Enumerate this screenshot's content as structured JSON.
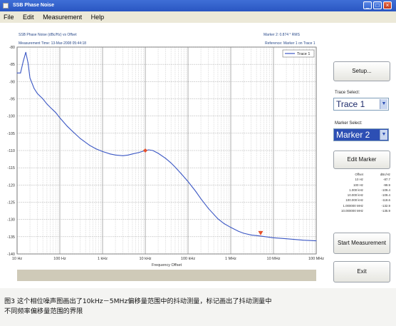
{
  "window": {
    "title": "SSB Phase Noise",
    "controls": [
      "_",
      "□",
      "×"
    ]
  },
  "menu": [
    "File",
    "Edit",
    "Measurement",
    "Help"
  ],
  "plot": {
    "title": "SSB Phase Noise (dBc/Hz) vs Offset",
    "marker_readout": "Marker 2: 0.874 ° RMS",
    "measurement_time": "Measurement Time: 13-Mar-2008 05:44:18",
    "reference": "Reference: Marker 1 on Trace 1",
    "legend": "Trace 1",
    "xlabel": "Frequency Offset"
  },
  "chart_data": {
    "type": "line",
    "title": "SSB Phase Noise (dBc/Hz) vs Offset",
    "xlabel": "Frequency Offset",
    "ylabel": "",
    "xscale": "log",
    "xlim": [
      10,
      100000000
    ],
    "ylim": [
      -140,
      -80
    ],
    "grid": true,
    "legend_position": "top-right",
    "x_tick_labels": [
      "10 Hz",
      "100 Hz",
      "1 kHz",
      "10 kHz",
      "100 kHz",
      "1 MHz",
      "10 MHz",
      "100 MHz"
    ],
    "y_tick_labels": [
      "-80",
      "-85",
      "-90",
      "-95",
      "-100",
      "-105",
      "-110",
      "-115",
      "-120",
      "-125",
      "-130",
      "-135",
      "-140"
    ],
    "series": [
      {
        "name": "Trace 1",
        "color": "#3b57c4",
        "x": [
          10,
          12,
          14,
          16,
          18,
          20,
          25,
          30,
          40,
          50,
          60,
          80,
          100,
          150,
          200,
          300,
          500,
          700,
          1000,
          1500,
          2000,
          3000,
          4000,
          5000,
          7000,
          10000,
          12000,
          15000,
          20000,
          30000,
          40000,
          50000,
          70000,
          100000,
          150000,
          200000,
          300000,
          500000,
          700000,
          1000000,
          1500000,
          2000000,
          3000000,
          5000000,
          10000000,
          20000000,
          50000000,
          100000000
        ],
        "y": [
          -87.5,
          -87.5,
          -84.0,
          -81.5,
          -84.5,
          -89.0,
          -92.0,
          -93.5,
          -95.0,
          -96.5,
          -97.5,
          -99.0,
          -100.5,
          -103.0,
          -104.5,
          -106.5,
          -108.5,
          -109.5,
          -110.3,
          -111.0,
          -111.3,
          -111.5,
          -111.3,
          -111.0,
          -110.6,
          -110.0,
          -109.8,
          -110.0,
          -110.8,
          -112.3,
          -113.6,
          -114.8,
          -116.8,
          -119.0,
          -121.8,
          -124.0,
          -126.8,
          -129.8,
          -131.2,
          -132.3,
          -133.4,
          -134.0,
          -134.5,
          -134.8,
          -135.3,
          -135.6,
          -136.0,
          -136.2
        ]
      }
    ],
    "markers": [
      {
        "label": "Marker 1",
        "x": 10000,
        "y": -110.0,
        "color": "#e5512a"
      },
      {
        "label": "Marker 2",
        "x": 5000000,
        "y": -134.8,
        "color": "#e5512a"
      }
    ]
  },
  "panel": {
    "setup_button": "Setup...",
    "trace_select_label": "Trace Select:",
    "trace_select_value": "Trace 1",
    "marker_select_label": "Marker Select:",
    "marker_select_value": "Marker 2",
    "edit_marker_button": "Edit Marker",
    "table_header": [
      "Offset",
      "dBc/Hz"
    ],
    "table_rows": [
      [
        "10 Hz",
        "-87.7"
      ],
      [
        "100 Hz",
        "-99.9"
      ],
      [
        "1.000 kHz",
        "-109.4"
      ],
      [
        "10.000 kHz",
        "-109.4"
      ],
      [
        "100.000 kHz",
        "-118.6"
      ],
      [
        "1.000000 MHz",
        "-132.9"
      ],
      [
        "10.000000 MHz",
        "-135.9"
      ]
    ],
    "start_button": "Start Measurement",
    "exit_button": "Exit"
  },
  "caption": {
    "line1": "图3  这个相位噪声图画出了10kHz－5MHz偏移量范围中的抖动测量，标记画出了抖动测量中",
    "line2": "不同频率偏移量范围的界限"
  }
}
